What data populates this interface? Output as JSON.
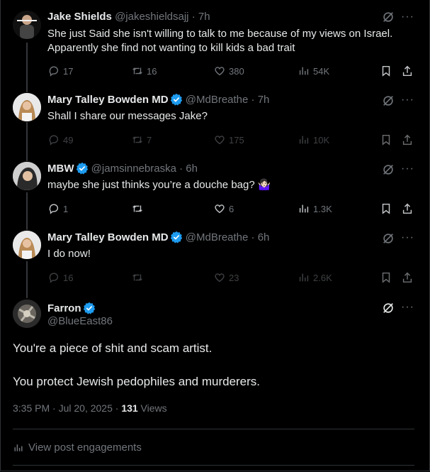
{
  "replies": [
    {
      "name": "Jake Shields",
      "handle": "@jakeshieldsajj",
      "time": "7h",
      "verified": false,
      "text": "She just Said she isn't willing to talk to me because of my views on Israel. Apparently she find not wanting to kill kids a bad trait",
      "replies_count": "17",
      "reposts_count": "16",
      "likes_count": "380",
      "views_count": "54K"
    },
    {
      "name": "Mary Talley Bowden MD",
      "handle": "@MdBreathe",
      "time": "7h",
      "verified": true,
      "text": "Shall I share our messages Jake?",
      "replies_count": "49",
      "reposts_count": "7",
      "likes_count": "175",
      "views_count": "10K"
    },
    {
      "name": "MBW",
      "handle": "@jamsinnebraska",
      "time": "6h",
      "verified": true,
      "text": "maybe she just thinks you’re a douche bag? 🤷🏻‍♀️",
      "replies_count": "1",
      "reposts_count": "",
      "likes_count": "6",
      "views_count": "1.3K"
    },
    {
      "name": "Mary Talley Bowden MD",
      "handle": "@MdBreathe",
      "time": "6h",
      "verified": true,
      "text": "I do now!",
      "replies_count": "16",
      "reposts_count": "",
      "likes_count": "23",
      "views_count": "2.6K"
    }
  ],
  "main": {
    "name": "Farron",
    "handle": "@BlueEast86",
    "text_line1": "You're a piece of shit and scam artist.",
    "text_line2": "You protect Jewish pedophiles and murderers.",
    "timestamp": "3:35 PM · Jul 20, 2025 · ",
    "views_count": "131",
    "views_label": " Views",
    "engagements_link": "View post engagements"
  },
  "colors": {
    "background": "#000000",
    "text": "#e7e9ea",
    "muted": "#71767b",
    "verified": "#1d9bf0",
    "divider": "#2f3336"
  },
  "icons": [
    "reply-icon",
    "repost-icon",
    "like-icon",
    "views-icon",
    "bookmark-icon",
    "share-icon",
    "grok-icon",
    "more-icon",
    "verified-badge-icon",
    "chart-icon"
  ]
}
